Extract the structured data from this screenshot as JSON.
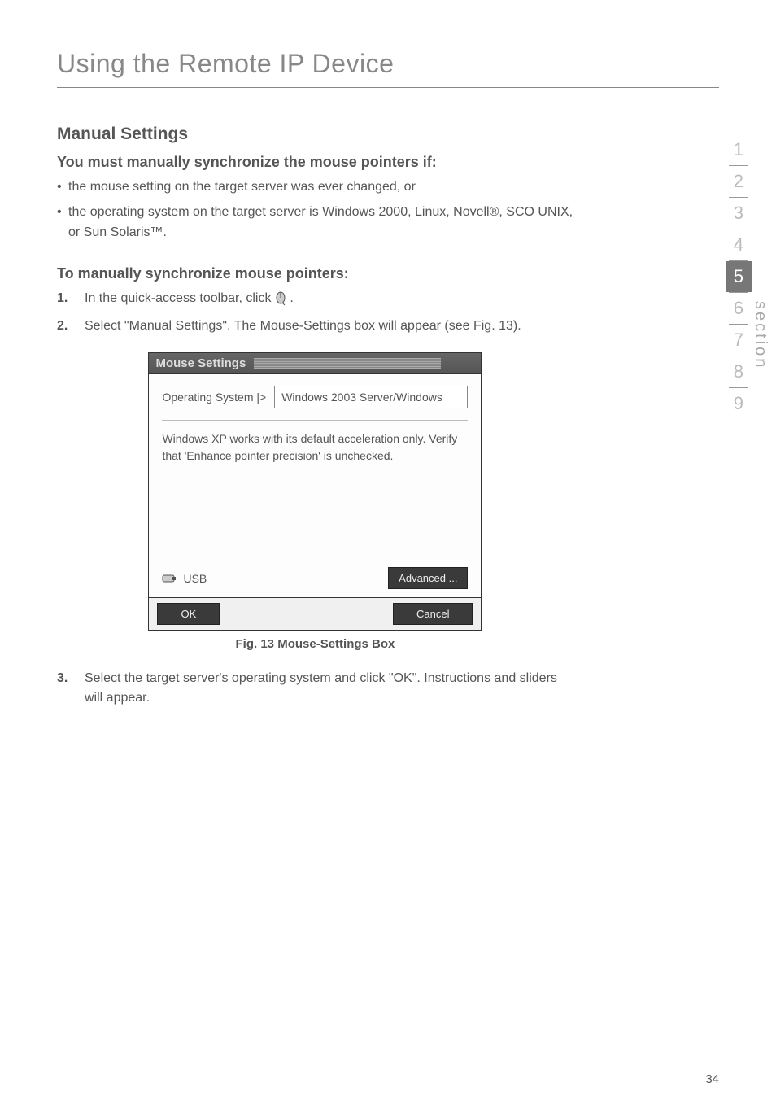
{
  "page": {
    "title": "Using the Remote IP Device",
    "number": "34"
  },
  "section": {
    "heading": "Manual Settings",
    "sub1": "You must manually synchronize the mouse pointers if:",
    "bullets": [
      "the mouse setting on the target server was ever changed, or",
      "the operating system on the target server is Windows 2000, Linux, Novell®, SCO UNIX, or Sun Solaris™."
    ],
    "sub2": "To manually synchronize mouse pointers:",
    "steps": [
      {
        "num": "1.",
        "text_before": "In the quick-access toolbar, click ",
        "text_after": "."
      },
      {
        "num": "2.",
        "text": "Select \"Manual Settings\". The Mouse-Settings box will appear (see Fig. 13)."
      },
      {
        "num": "3.",
        "text": "Select the target server's operating system and click \"OK\". Instructions and sliders will appear."
      }
    ]
  },
  "dialog": {
    "title": "Mouse Settings",
    "os_label": "Operating System |>",
    "os_value": "Windows 2003 Server/Windows",
    "note": "Windows XP works with its default acceleration only. Verify that 'Enhance pointer precision' is unchecked.",
    "usb_label": "USB",
    "advanced_btn": "Advanced ...",
    "ok_btn": "OK",
    "cancel_btn": "Cancel",
    "caption": "Fig. 13 Mouse-Settings Box"
  },
  "sidebar": {
    "items": [
      "1",
      "2",
      "3",
      "4",
      "5",
      "6",
      "7",
      "8",
      "9"
    ],
    "active_index": 4,
    "label": "section"
  }
}
